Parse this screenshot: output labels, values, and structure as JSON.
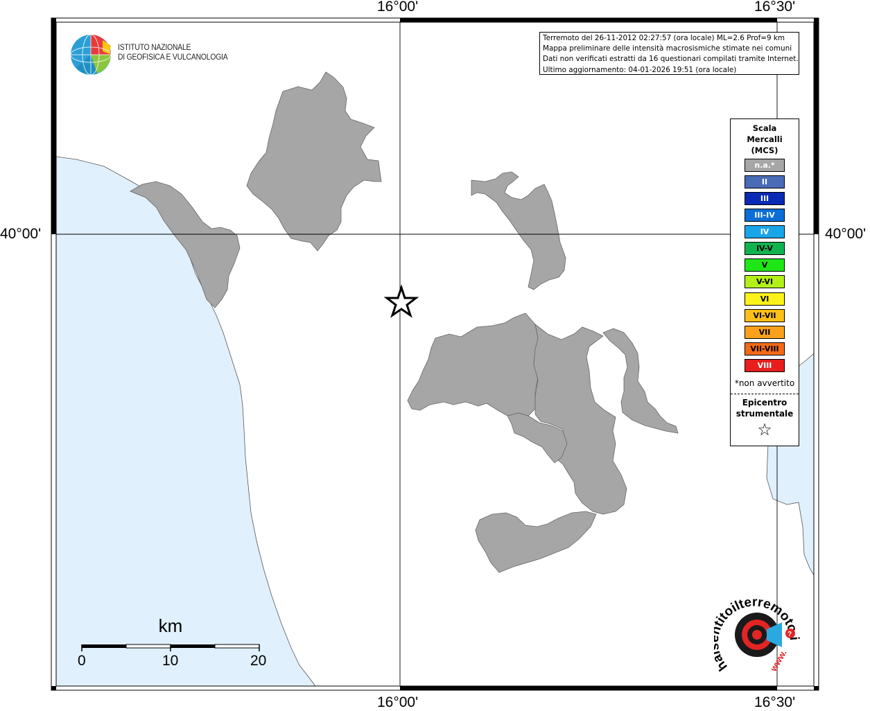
{
  "map": {
    "coord_labels": {
      "top_lon_1": "16°00'",
      "top_lon_2": "16°30'",
      "bottom_lon_1": "16°00'",
      "bottom_lon_2": "16°30'",
      "left_lat": "40°00'",
      "right_lat": "40°00'"
    },
    "colors": {
      "sea": "#e0f0fc",
      "land": "#ffffff",
      "municipality_na": "#a6a6a6",
      "frame": "#000000"
    },
    "municipalities": [
      {
        "name": "municipality-northwest",
        "intensity": "n.a.*"
      },
      {
        "name": "municipality-north",
        "intensity": "n.a.*"
      },
      {
        "name": "municipality-northeast",
        "intensity": "n.a.*"
      },
      {
        "name": "municipality-east-1",
        "intensity": "n.a.*"
      },
      {
        "name": "municipality-east-2",
        "intensity": "n.a.*"
      },
      {
        "name": "municipality-east-3",
        "intensity": "n.a.*"
      },
      {
        "name": "municipality-east-4",
        "intensity": "n.a.*"
      },
      {
        "name": "municipality-south",
        "intensity": "n.a.*"
      }
    ],
    "epicenter_symbol": "star-icon"
  },
  "info": {
    "line1": "Terremoto del 26-11-2012 02:27:57 (ora locale) ML=2.6 Prof=9 km",
    "line2": "Mappa preliminare delle intensità macrosismiche stimate nei comuni",
    "line3": "Dati non verificati estratti da 16 questionari compilati tramite Internet.",
    "line4": "Ultimo aggiornamento: 04-01-2026 19:51 (ora locale)"
  },
  "logo": {
    "line1": "ISTITUTO NAZIONALE",
    "line2": "DI GEOFISICA E VULCANOLOGIA"
  },
  "legend": {
    "title_line1": "Scala",
    "title_line2": "Mercalli",
    "title_line3": "(MCS)",
    "items": [
      {
        "label": "n.a.*",
        "color": "#a6a6a6"
      },
      {
        "label": "II",
        "color": "#4a6bb5"
      },
      {
        "label": "III",
        "color": "#0a2ab5"
      },
      {
        "label": "III-IV",
        "color": "#0a6ed6"
      },
      {
        "label": "IV",
        "color": "#19a6e8"
      },
      {
        "label": "IV-V",
        "color": "#12b34f"
      },
      {
        "label": "V",
        "color": "#1ee617"
      },
      {
        "label": "V-VI",
        "color": "#b3f01a"
      },
      {
        "label": "VI",
        "color": "#fbf21a"
      },
      {
        "label": "VI-VII",
        "color": "#fbbf18"
      },
      {
        "label": "VII",
        "color": "#f9a11b"
      },
      {
        "label": "VII-VIII",
        "color": "#f36a17"
      },
      {
        "label": "VIII",
        "color": "#e81e1e"
      }
    ],
    "note": "*non avvertito",
    "epicenter_line1": "Epicentro",
    "epicenter_line2": "strumentale",
    "epicenter_icon": "☆"
  },
  "scale": {
    "unit": "km",
    "ticks": [
      "0",
      "10",
      "20"
    ]
  },
  "hai_logo": {
    "text": "haisentitoilterremoto.it",
    "sub": "www."
  }
}
